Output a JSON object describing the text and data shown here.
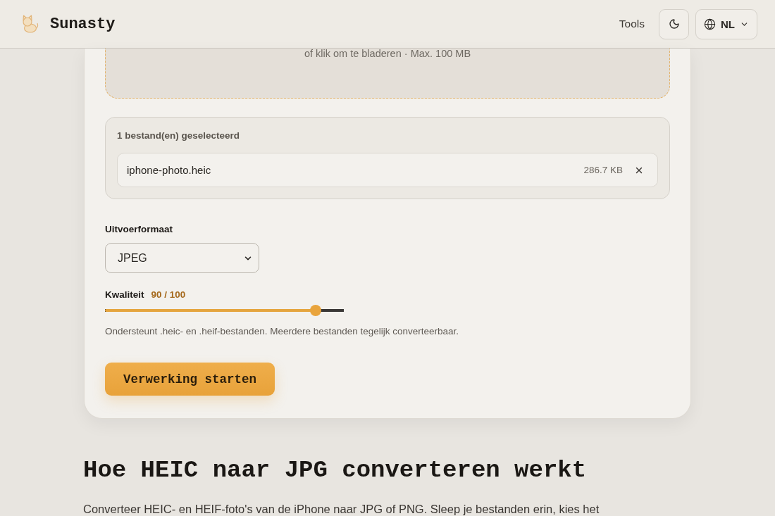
{
  "header": {
    "brand": "Sunasty",
    "nav": [
      {
        "label": "Tools"
      }
    ],
    "language": {
      "label": "NL"
    }
  },
  "upload": {
    "dropzone_hint": "of klik om te bladeren · Max. 100 MB",
    "selected_title": "1 bestand(en) geselecteerd",
    "files": [
      {
        "name": "iphone-photo.heic",
        "size": "286.7 KB"
      }
    ]
  },
  "format": {
    "label": "Uitvoerformaat",
    "value": "JPEG"
  },
  "quality": {
    "label": "Kwaliteit",
    "reading": "90 / 100",
    "level": 0.9
  },
  "help_text": "Ondersteunt .heic- en .heif-bestanden. Meerdere bestanden tegelijk converteerbaar.",
  "submit": {
    "label": "Verwerking starten"
  },
  "article": {
    "heading": "Hoe HEIC naar JPG converteren werkt",
    "paragraph": "Converteer HEIC- en HEIF-foto's van de iPhone naar JPG of PNG. Sleep je bestanden erin, kies het"
  }
}
